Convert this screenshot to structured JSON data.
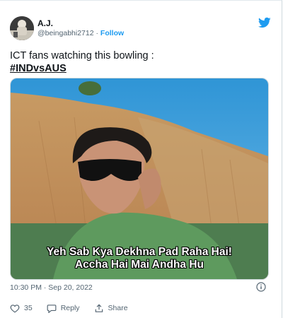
{
  "tweet": {
    "author": {
      "display_name": "A.J.",
      "handle": "@beingabhi2712",
      "follow_label": "Follow",
      "avatar_icon": "profile-photo"
    },
    "text_line": "ICT fans watching this bowling :",
    "hashtag": "#INDvsAUS",
    "media": {
      "caption_line1": "Yeh Sab Kya Dekhna Pad Raha Hai!",
      "caption_line2": "Accha Hai Mai Andha Hu"
    },
    "timestamp": "10:30 PM · Sep 20, 2022",
    "actions": {
      "like_count": "35",
      "reply_label": "Reply",
      "share_label": "Share"
    }
  },
  "colors": {
    "brand_blue": "#1d9bf0",
    "secondary_text": "#536471",
    "like_icon": "heart-icon",
    "reply_icon": "comment-icon",
    "share_icon": "share-icon"
  }
}
